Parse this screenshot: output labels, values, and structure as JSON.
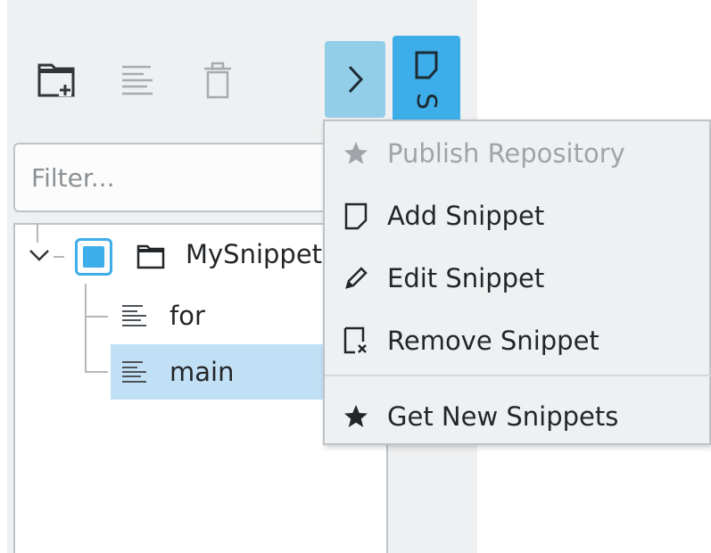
{
  "toolbar": {
    "new_folder_icon": "new-folder-icon",
    "snippet_list_icon": "text-lines-icon",
    "delete_icon": "trash-icon",
    "expand_icon": "chevron-right-icon",
    "dock_tab_icon": "snippet-page-icon",
    "dock_tab_text": "S"
  },
  "filter": {
    "placeholder": "Filter...",
    "value": ""
  },
  "tree": {
    "root": {
      "label": "MySnippets",
      "checked": true
    },
    "items": [
      {
        "label": "for",
        "selected": false
      },
      {
        "label": "main",
        "selected": true
      }
    ]
  },
  "menu": {
    "items": [
      {
        "label": "Publish Repository",
        "icon": "star-icon",
        "enabled": false
      },
      {
        "label": "Add Snippet",
        "icon": "page-icon",
        "enabled": true
      },
      {
        "label": "Edit Snippet",
        "icon": "pencil-icon",
        "enabled": true
      },
      {
        "label": "Remove Snippet",
        "icon": "remove-page-icon",
        "enabled": true
      },
      {
        "label": "Get New Snippets",
        "icon": "star-icon",
        "enabled": true
      }
    ]
  },
  "colors": {
    "accent": "#3daee9",
    "accent_light": "#93cee9",
    "selection": "#c2e0f5",
    "panel_bg": "#eff0f1",
    "text": "#232629",
    "disabled_text": "#a0a4a8"
  }
}
